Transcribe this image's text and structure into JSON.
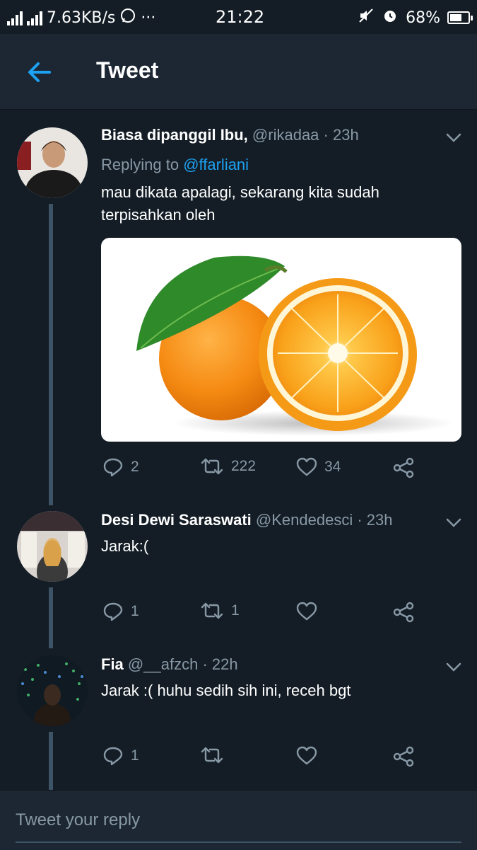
{
  "status_bar": {
    "network_speed": "7.63KB/s",
    "dots": "···",
    "time": "21:22",
    "battery": "68%",
    "battery_level": 0.68
  },
  "header": {
    "title": "Tweet"
  },
  "tweets": [
    {
      "name": "Biasa dipanggil Ibu,",
      "handle": "@rikadaa",
      "time": "23h",
      "replying_label": "Replying to",
      "replying_to": "@ffarliani",
      "text_line1": "mau dikata apalagi, sekarang kita sudah",
      "text_line2": "terpisahkan oleh",
      "actions": {
        "replies": "2",
        "retweets": "222",
        "likes": "34"
      }
    },
    {
      "name": "Desi Dewi Saraswati",
      "handle": "@Kendedesci",
      "time": "23h",
      "text": "Jarak:(",
      "actions": {
        "replies": "1",
        "retweets": "1",
        "likes": ""
      }
    },
    {
      "name": "Fia",
      "handle": "@__afzch",
      "time": "22h",
      "text": "Jarak :( huhu sedih sih ini, receh bgt",
      "actions": {
        "replies": "1",
        "retweets": "",
        "likes": ""
      }
    }
  ],
  "reply_bar": {
    "placeholder": "Tweet your reply"
  },
  "colors": {
    "background": "#141d26",
    "header": "#1c2733",
    "accent": "#1da1f2",
    "muted": "#8899a6"
  },
  "icons": [
    "back-arrow-icon",
    "chevron-down-icon",
    "reply-icon",
    "retweet-icon",
    "like-icon",
    "share-icon"
  ]
}
